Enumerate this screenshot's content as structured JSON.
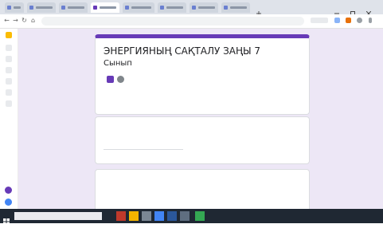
{
  "browser": {
    "tabs": [
      {
        "title": "",
        "active": false
      },
      {
        "title": "",
        "active": false
      },
      {
        "title": "",
        "active": false
      },
      {
        "title": "",
        "active": true
      },
      {
        "title": "",
        "active": false
      },
      {
        "title": "",
        "active": false
      },
      {
        "title": "",
        "active": false
      },
      {
        "title": "",
        "active": false
      }
    ],
    "url_text": "",
    "url_center_text": ""
  },
  "form": {
    "title": "ЭНЕРГИЯНЫҢ САҚТАЛУ ЗАҢЫ 7",
    "subtitle": "Сынып",
    "meta_text": "",
    "description": "",
    "questions": [
      {
        "title": "",
        "answer": ""
      },
      {
        "title": "",
        "answer": ""
      }
    ],
    "accent_color": "#673ab7",
    "background_color": "#ede7f6"
  },
  "taskbar": {
    "search_placeholder": "",
    "tray_text": ""
  }
}
